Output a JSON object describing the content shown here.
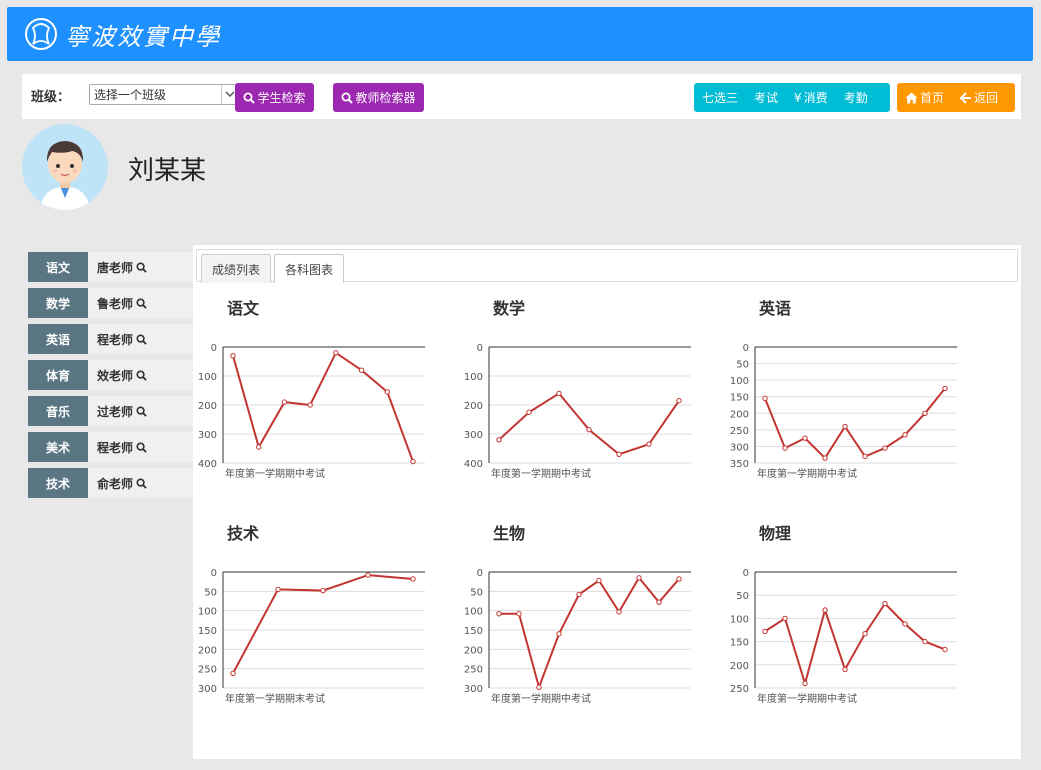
{
  "header": {
    "school_name": "寧波效實中學"
  },
  "toolbar": {
    "class_label": "班级：",
    "class_select": "选择一个班级",
    "student_search": "学生检索",
    "teacher_search": "教师检索器",
    "group1": [
      "七选三",
      "考试",
      "消费",
      "考勤"
    ],
    "home": "首页",
    "back": "返回"
  },
  "student": {
    "name": "刘某某"
  },
  "subjects": [
    {
      "subject": "语文",
      "teacher": "唐老师"
    },
    {
      "subject": "数学",
      "teacher": "鲁老师"
    },
    {
      "subject": "英语",
      "teacher": "程老师"
    },
    {
      "subject": "体育",
      "teacher": "效老师"
    },
    {
      "subject": "音乐",
      "teacher": "过老师"
    },
    {
      "subject": "美术",
      "teacher": "程老师"
    },
    {
      "subject": "技术",
      "teacher": "俞老师"
    }
  ],
  "tabs": [
    "成绩列表",
    "各科图表"
  ],
  "colors": {
    "line": "#c23531",
    "brand": "#1e90ff",
    "purple": "#9c27b0",
    "cyan": "#00bcd4",
    "orange": "#ff9800",
    "tag": "#5a7683"
  },
  "chart_data": [
    {
      "type": "line",
      "title": "语文",
      "inverse_y": true,
      "ylim": [
        0,
        400
      ],
      "yticks": [
        "0",
        "100",
        "200",
        "300",
        "400"
      ],
      "ytick_values": [
        0,
        100,
        200,
        300,
        400
      ],
      "xlabel_visible": "年度第一学期期中考试",
      "values": [
        30,
        345,
        190,
        200,
        20,
        80,
        155,
        395
      ]
    },
    {
      "type": "line",
      "title": "数学",
      "inverse_y": true,
      "ylim": [
        0,
        400
      ],
      "yticks": [
        "0",
        "100",
        "200",
        "300",
        "400"
      ],
      "ytick_values": [
        0,
        100,
        200,
        300,
        400
      ],
      "xlabel_visible": "年度第一学期期中考试",
      "values": [
        320,
        225,
        160,
        285,
        370,
        335,
        185
      ]
    },
    {
      "type": "line",
      "title": "英语",
      "inverse_y": true,
      "ylim": [
        0,
        350
      ],
      "yticks": [
        "0",
        "50",
        "100",
        "150",
        "200",
        "250",
        "300",
        "350"
      ],
      "ytick_values": [
        0,
        50,
        100,
        150,
        200,
        250,
        300,
        350
      ],
      "xlabel_visible": "年度第一学期期中考试",
      "values": [
        155,
        305,
        275,
        335,
        240,
        330,
        305,
        265,
        200,
        125
      ]
    },
    {
      "type": "line",
      "title": "技术",
      "inverse_y": true,
      "ylim": [
        0,
        300
      ],
      "yticks": [
        "0",
        "50",
        "100",
        "150",
        "200",
        "250",
        "300"
      ],
      "ytick_values": [
        0,
        50,
        100,
        150,
        200,
        250,
        300
      ],
      "xlabel_visible": "年度第一学期期末考试",
      "values": [
        262,
        45,
        48,
        8,
        18
      ]
    },
    {
      "type": "line",
      "title": "生物",
      "inverse_y": true,
      "ylim": [
        0,
        300
      ],
      "yticks": [
        "0",
        "50",
        "100",
        "150",
        "200",
        "250",
        "300"
      ],
      "ytick_values": [
        0,
        50,
        100,
        150,
        200,
        250,
        300
      ],
      "xlabel_visible": "年度第一学期期中考试",
      "values": [
        108,
        108,
        298,
        160,
        58,
        22,
        103,
        15,
        78,
        18
      ]
    },
    {
      "type": "line",
      "title": "物理",
      "inverse_y": true,
      "ylim": [
        0,
        250
      ],
      "yticks": [
        "0",
        "50",
        "100",
        "150",
        "200",
        "250"
      ],
      "ytick_values": [
        0,
        50,
        100,
        150,
        200,
        250
      ],
      "xlabel_visible": "年度第一学期期中考试",
      "values": [
        128,
        100,
        240,
        82,
        210,
        133,
        68,
        112,
        150,
        167
      ]
    }
  ]
}
